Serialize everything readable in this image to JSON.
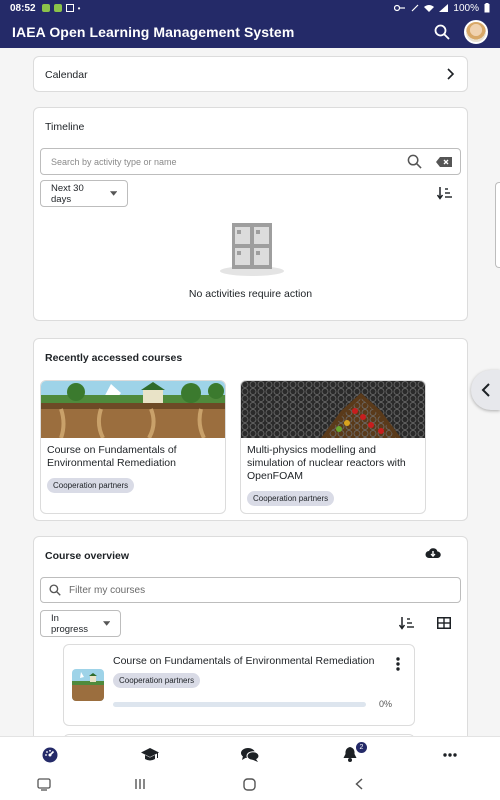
{
  "status": {
    "time": "08:52",
    "battery": "100%"
  },
  "app": {
    "title": "IAEA Open Learning Management System"
  },
  "calendar": {
    "label": "Calendar"
  },
  "timeline": {
    "title": "Timeline",
    "search_placeholder": "Search by activity type or name",
    "range": "Next 30 days",
    "empty_text": "No activities require action"
  },
  "recent": {
    "title": "Recently accessed courses",
    "courses": [
      {
        "name": "Course on Fundamentals of Environmental Remediation",
        "category": "Cooperation partners"
      },
      {
        "name": "Multi-physics modelling and simulation of nuclear reactors with OpenFOAM",
        "category": "Cooperation partners"
      }
    ]
  },
  "overview": {
    "title": "Course overview",
    "filter_placeholder": "Filter my courses",
    "grouping": "In progress",
    "courses": [
      {
        "name": "Course on Fundamentals of Environmental Remediation",
        "category": "Cooperation partners",
        "progress_label": "0%",
        "progress": 0
      }
    ]
  },
  "tabs": {
    "notifications_count": "2"
  },
  "colors": {
    "brand": "#242a68",
    "badge_bg": "#d9dbe6"
  }
}
